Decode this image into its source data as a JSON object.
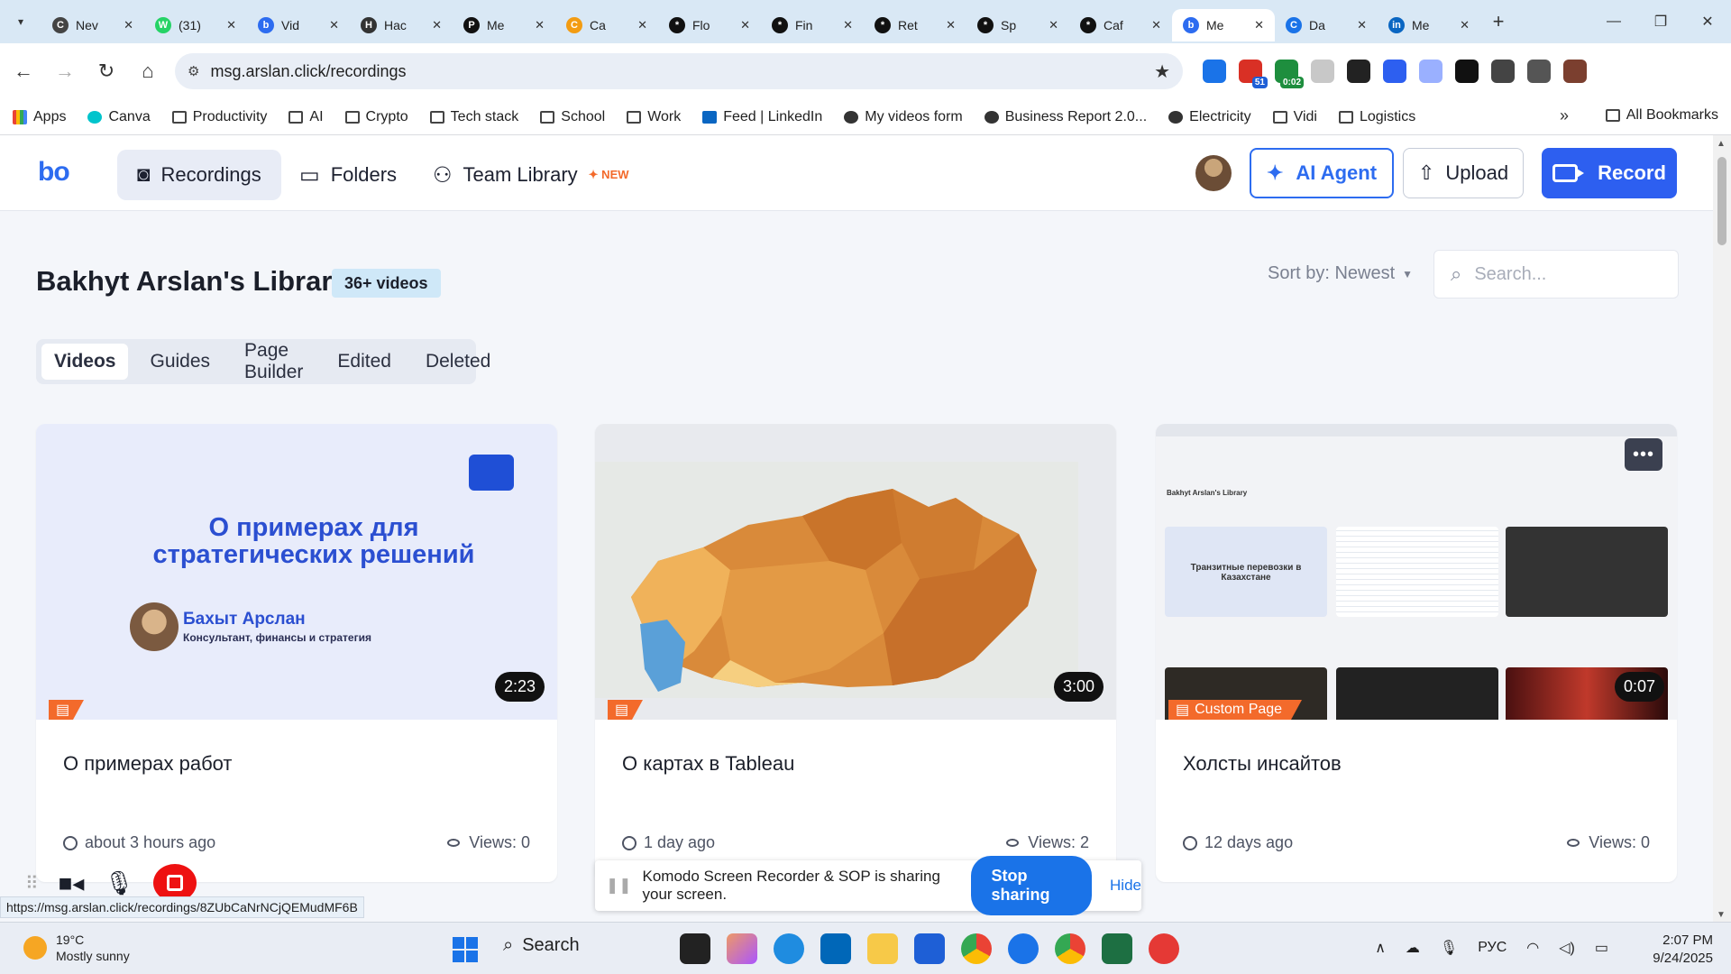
{
  "browser": {
    "tabs": [
      {
        "label": "Nev",
        "fav": "C",
        "color": "#444"
      },
      {
        "label": "(31)",
        "fav": "W",
        "color": "#25d366"
      },
      {
        "label": "Vid",
        "fav": "b",
        "color": "#2d6cf0"
      },
      {
        "label": "Hac",
        "fav": "H",
        "color": "#333"
      },
      {
        "label": "Me",
        "fav": "P",
        "color": "#111"
      },
      {
        "label": "Ca",
        "fav": "C",
        "color": "#f39c12"
      },
      {
        "label": "Flo",
        "fav": "*",
        "color": "#111"
      },
      {
        "label": "Fin",
        "fav": "*",
        "color": "#111"
      },
      {
        "label": "Ret",
        "fav": "*",
        "color": "#111"
      },
      {
        "label": "Sp",
        "fav": "*",
        "color": "#111"
      },
      {
        "label": "Caf",
        "fav": "*",
        "color": "#111"
      },
      {
        "label": "Me",
        "fav": "b",
        "color": "#2d6cf0",
        "active": true
      },
      {
        "label": "Da",
        "fav": "C",
        "color": "#1a73e8"
      },
      {
        "label": "Me",
        "fav": "in",
        "color": "#0a66c2"
      }
    ],
    "url": "msg.arslan.click/recordings",
    "extensions": [
      {
        "name": "1password-icon",
        "color": "#1a73e8",
        "badge": ""
      },
      {
        "name": "mail-icon",
        "color": "#d93025",
        "badge": "51"
      },
      {
        "name": "recorder-icon",
        "color": "#1e8e3e",
        "badge": "0:02"
      },
      {
        "name": "notes-icon",
        "color": "#c8c8c8",
        "badge": ""
      },
      {
        "name": "edit-icon",
        "color": "#222",
        "badge": ""
      },
      {
        "name": "video-icon",
        "color": "#2d5ff0",
        "badge": ""
      },
      {
        "name": "ai-icon",
        "color": "#9ab0ff",
        "badge": ""
      },
      {
        "name": "openai-icon",
        "color": "#111",
        "badge": ""
      },
      {
        "name": "spy-icon",
        "color": "#444",
        "badge": ""
      },
      {
        "name": "puzzle-icon",
        "color": "#555",
        "badge": ""
      },
      {
        "name": "profile-icon",
        "color": "#7b3f2f",
        "badge": ""
      }
    ],
    "bookmarks": [
      {
        "label": "Apps",
        "icon": "grid"
      },
      {
        "label": "Canva",
        "icon": "cv"
      },
      {
        "label": "Productivity",
        "icon": "folder"
      },
      {
        "label": "AI",
        "icon": "folder"
      },
      {
        "label": "Crypto",
        "icon": "folder"
      },
      {
        "label": "Tech stack",
        "icon": "folder"
      },
      {
        "label": "School",
        "icon": "folder"
      },
      {
        "label": "Work",
        "icon": "folder"
      },
      {
        "label": "Feed | LinkedIn",
        "icon": "li"
      },
      {
        "label": "My videos form",
        "icon": "dot"
      },
      {
        "label": "Business Report 2.0...",
        "icon": "dot"
      },
      {
        "label": "Electricity",
        "icon": "dot"
      },
      {
        "label": "Vidi",
        "icon": "folder"
      },
      {
        "label": "Logistics",
        "icon": "folder"
      }
    ],
    "all_bookmarks": "All Bookmarks",
    "status_url": "https://msg.arslan.click/recordings/8ZUbCaNrNCjQEMudMF6B"
  },
  "app": {
    "logo": "bo",
    "nav": {
      "recordings": "Recordings",
      "folders": "Folders",
      "team_library": "Team Library",
      "new_badge": "✦ NEW"
    },
    "buttons": {
      "agent": "AI Agent",
      "upload": "Upload",
      "record": "Record"
    }
  },
  "library": {
    "title": "Bakhyt Arslan's Library",
    "count": "36+ videos",
    "sort": "Sort by: Newest",
    "search_placeholder": "Search...",
    "tabs": [
      "Videos",
      "Guides",
      "Page Builder",
      "Edited",
      "Deleted"
    ],
    "active_tab": "Videos"
  },
  "cards": [
    {
      "title": "О примерах работ",
      "time": "about 3 hours ago",
      "views": "Views: 0",
      "duration": "2:23",
      "tag": "",
      "thumb": {
        "title": "О примерах для стратегических решений",
        "name": "Бахыт Арслан",
        "role": "Консультант, финансы и стратегия"
      }
    },
    {
      "title": "О картах в Tableau",
      "time": "1 day ago",
      "views": "Views: 2",
      "duration": "3:00",
      "tag": ""
    },
    {
      "title": "Холсты инсайтов",
      "time": "12 days ago",
      "views": "Views: 0",
      "duration": "0:07",
      "tag": "Custom Page",
      "thumb": {
        "lib_title": "Bakhyt Arslan's Library",
        "mini_title": "Транзитные перевозки в Казахстане"
      }
    }
  ],
  "share": {
    "message": "Komodo Screen Recorder & SOP is sharing your screen.",
    "stop": "Stop sharing",
    "hide": "Hide"
  },
  "taskbar": {
    "temp": "19°C",
    "weather": "Mostly sunny",
    "search": "Search",
    "lang": "РУС",
    "time": "2:07 PM",
    "date": "9/24/2025"
  }
}
